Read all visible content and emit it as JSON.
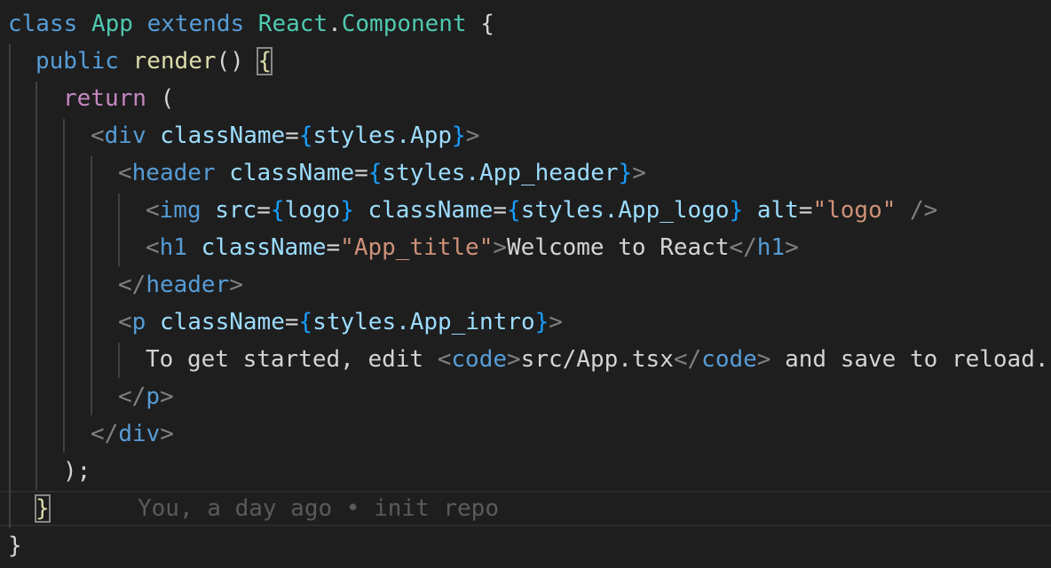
{
  "code": {
    "line1": {
      "kw_class": "class",
      "name": "App",
      "kw_extends": "extends",
      "base_ns": "React",
      "dot": ".",
      "base_cls": "Component",
      "brace": " {"
    },
    "line2": {
      "kw_public": "public",
      "method": "render",
      "parens": "() ",
      "brace": "{"
    },
    "line3": {
      "kw_return": "return",
      "paren": " ("
    },
    "line4": {
      "lt": "<",
      "tag": "div",
      "attr": "className",
      "eq": "=",
      "ob": "{",
      "expr": "styles.App",
      "cb": "}",
      "gt": ">"
    },
    "line5": {
      "lt": "<",
      "tag": "header",
      "attr": "className",
      "eq": "=",
      "ob": "{",
      "expr": "styles.App_header",
      "cb": "}",
      "gt": ">"
    },
    "line6": {
      "lt": "<",
      "tag": "img",
      "attr_src": "src",
      "eq1": "=",
      "ob1": "{",
      "expr_src": "logo",
      "cb1": "}",
      "attr_class": "className",
      "eq2": "=",
      "ob2": "{",
      "expr_class": "styles.App_logo",
      "cb2": "}",
      "attr_alt": "alt",
      "eq3": "=",
      "str_alt": "\"logo\"",
      "close": "/>"
    },
    "line7": {
      "lt": "<",
      "tag": "h1",
      "attr": "className",
      "eq": "=",
      "str": "\"App_title\"",
      "gt": ">",
      "text": "Welcome to React",
      "lt_close": "</",
      "tag_close": "h1",
      "gt_close": ">"
    },
    "line8": {
      "lt": "</",
      "tag": "header",
      "gt": ">"
    },
    "line9": {
      "lt": "<",
      "tag": "p",
      "attr": "className",
      "eq": "=",
      "ob": "{",
      "expr": "styles.App_intro",
      "cb": "}",
      "gt": ">"
    },
    "line10": {
      "text1": "To get started, edit ",
      "lt": "<",
      "tag": "code",
      "gt": ">",
      "text2": "src/App.tsx",
      "lt_close": "</",
      "tag_close": "code",
      "gt_close": ">",
      "text3": " and save to reload."
    },
    "line11": {
      "lt": "</",
      "tag": "p",
      "gt": ">"
    },
    "line12": {
      "lt": "</",
      "tag": "div",
      "gt": ">"
    },
    "line13": {
      "text": ");"
    },
    "line14": {
      "brace": "}",
      "blame": "You, a day ago • init repo"
    },
    "line15": {
      "brace": "}"
    }
  }
}
